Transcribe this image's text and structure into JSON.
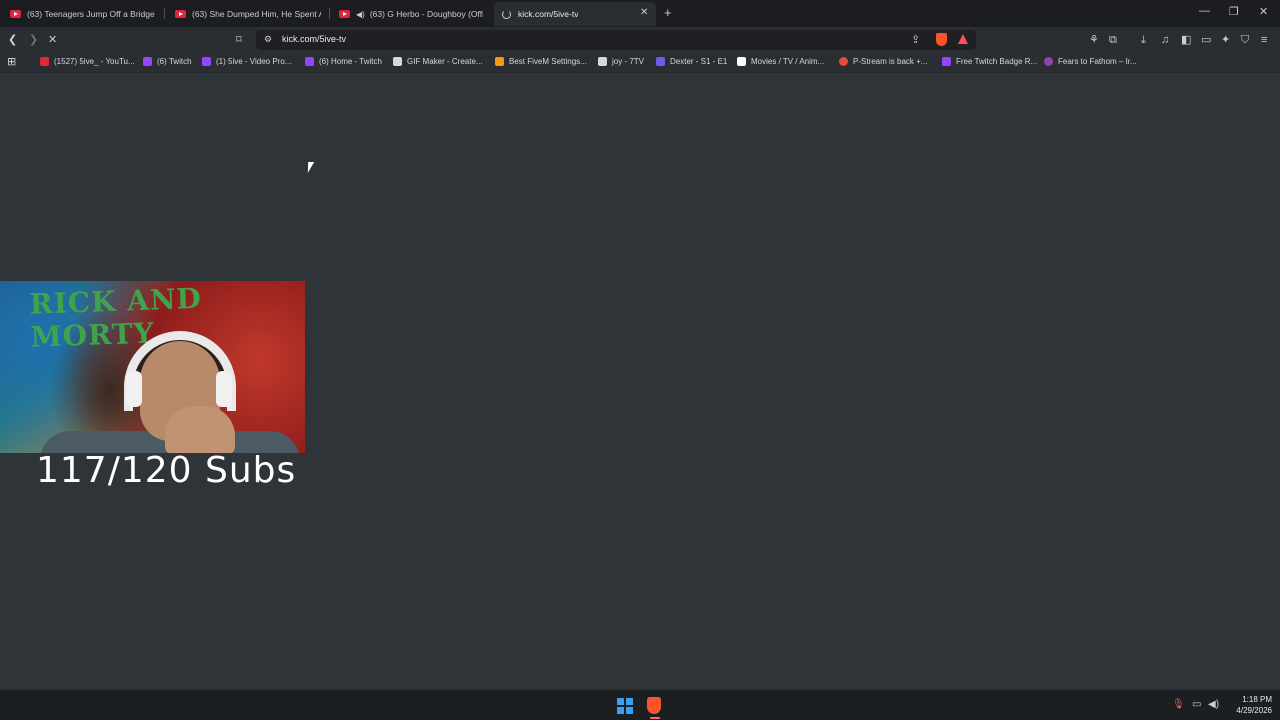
{
  "tabs": [
    {
      "title": "(63) Teenagers Jump Off a Bridge Aft",
      "icon": "youtube-icon",
      "audio": false
    },
    {
      "title": "(63) She Dumped Him, He Spent A Ye",
      "icon": "youtube-icon",
      "audio": false
    },
    {
      "title": "(63) G Herbo - Doughboy (Officia",
      "icon": "youtube-icon",
      "audio": true
    },
    {
      "title": "kick.com/5ive-tv",
      "icon": "loading-spinner-icon",
      "active": true
    }
  ],
  "toolbar": {
    "url": "kick.com/5ive-tv"
  },
  "bookmarks": [
    {
      "label": "(1527) 5ive_ - YouTu...",
      "color": "#e0263c"
    },
    {
      "label": "(6) Twitch",
      "color": "#9146ff"
    },
    {
      "label": "(1) 5ive - Video Pro...",
      "color": "#9146ff"
    },
    {
      "label": "(6) Home - Twitch",
      "color": "#9146ff"
    },
    {
      "label": "GIF Maker - Create...",
      "color": "#d5d8dc"
    },
    {
      "label": "Best FiveM Settings...",
      "color": "#f39c12"
    },
    {
      "label": "joy - 7TV",
      "color": "#d5d8dc"
    },
    {
      "label": "Dexter - S1 - E1",
      "color": "#6c5ce7"
    },
    {
      "label": "Movies / TV / Anim...",
      "color": "#ffffff"
    },
    {
      "label": "P-Stream is back +...",
      "color": "#e74c3c"
    },
    {
      "label": "Free Twitch Badge R...",
      "color": "#9146ff"
    },
    {
      "label": "Fears to Fathom – Ir...",
      "color": "#8e44ad"
    }
  ],
  "content": {
    "webcam_banner": "RICK AND MORTY",
    "subs_text": "117/120 Subs"
  },
  "taskbar": {
    "time": "1:18 PM",
    "date": "4/29/2026"
  }
}
